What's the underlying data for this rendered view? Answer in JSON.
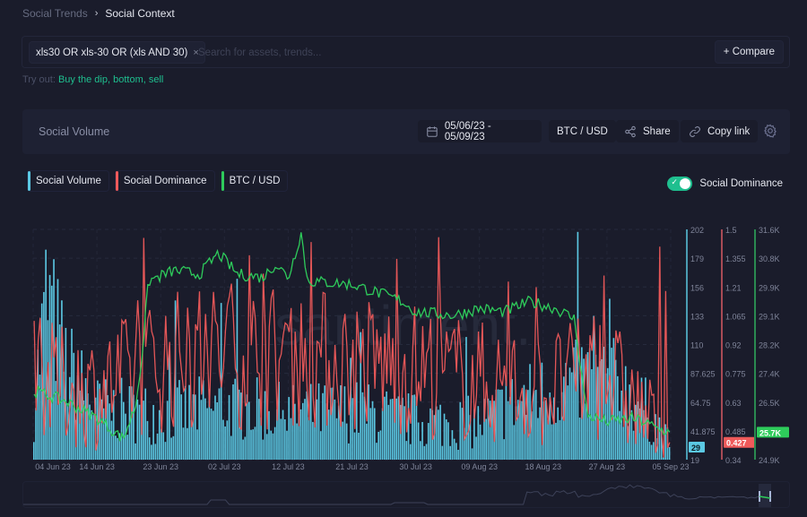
{
  "breadcrumb": {
    "parent": "Social Trends",
    "separator": "›",
    "current": "Social Context"
  },
  "search": {
    "tag": "xls30 OR xls-30 OR (xls AND 30)",
    "tag_close": "×",
    "placeholder": "Search for assets, trends...",
    "compare_label": "+ Compare"
  },
  "tryout": {
    "label": "Try out:",
    "suggestions": "Buy the dip, bottom, sell"
  },
  "panel": {
    "title": "Social Volume",
    "date_range": "05/06/23 - 05/09/23",
    "pair": "BTC / USD",
    "share_label": "Share",
    "copy_link_label": "Copy link"
  },
  "legend": [
    {
      "label": "Social Volume",
      "color": "#5bc8e3"
    },
    {
      "label": "Social Dominance",
      "color": "#ef5a5a"
    },
    {
      "label": "BTC / USD",
      "color": "#2ecc5b"
    }
  ],
  "toggle": {
    "label": "Social Dominance",
    "on": true
  },
  "watermark": "santiment.",
  "chart_data": {
    "type": "line",
    "title": "Social Volume",
    "x_ticks": [
      "04 Jun 23",
      "14 Jun 23",
      "23 Jun 23",
      "02 Jul 23",
      "12 Jul 23",
      "21 Jul 23",
      "30 Jul 23",
      "09 Aug 23",
      "18 Aug 23",
      "27 Aug 23",
      "05 Sep 23"
    ],
    "x_range": [
      "04 Jun 23",
      "05 Sep 23"
    ],
    "axes": [
      {
        "name": "Social Volume",
        "color": "#5bc8e3",
        "range": [
          19,
          202
        ],
        "ticks": [
          "202",
          "179",
          "156",
          "133",
          "110",
          "87.625",
          "64.75",
          "41.875",
          "19"
        ],
        "latest": "29",
        "latest_value": 29
      },
      {
        "name": "Social Dominance",
        "color": "#ef5a5a",
        "range": [
          0.34,
          1.5
        ],
        "ticks": [
          "1.5",
          "1.355",
          "1.21",
          "1.065",
          "0.92",
          "0.775",
          "0.63",
          "0.485",
          "0.34"
        ],
        "latest": "0.427",
        "latest_value": 0.427
      },
      {
        "name": "BTC / USD",
        "color": "#2ecc5b",
        "range": [
          24900,
          31600
        ],
        "ticks": [
          "31.6K",
          "30.8K",
          "29.9K",
          "29.1K",
          "28.2K",
          "27.4K",
          "26.5K",
          "25.7K",
          "24.9K"
        ],
        "latest": "25.7K",
        "latest_value": 25700
      }
    ],
    "series": [
      {
        "name": "Social Volume",
        "kind": "bar",
        "axis": 0,
        "color": "#5bc8e3",
        "keypoints": [
          [
            0,
            60
          ],
          [
            0.02,
            150
          ],
          [
            0.05,
            95
          ],
          [
            0.1,
            60
          ],
          [
            0.2,
            55
          ],
          [
            0.3,
            62
          ],
          [
            0.4,
            55
          ],
          [
            0.5,
            58
          ],
          [
            0.6,
            50
          ],
          [
            0.7,
            48
          ],
          [
            0.74,
            60
          ],
          [
            0.8,
            72
          ],
          [
            0.88,
            85
          ],
          [
            0.92,
            80
          ],
          [
            0.97,
            55
          ],
          [
            1,
            29
          ]
        ]
      },
      {
        "name": "Social Dominance",
        "kind": "line",
        "axis": 1,
        "color": "#ef5a5a",
        "keypoints": [
          [
            0,
            0.75
          ],
          [
            0.1,
            0.7
          ],
          [
            0.2,
            0.85
          ],
          [
            0.3,
            0.9
          ],
          [
            0.4,
            0.88
          ],
          [
            0.5,
            0.85
          ],
          [
            0.6,
            0.82
          ],
          [
            0.7,
            0.75
          ],
          [
            0.8,
            0.7
          ],
          [
            0.9,
            0.8
          ],
          [
            1,
            0.427
          ]
        ]
      },
      {
        "name": "BTC / USD",
        "kind": "line",
        "axis": 2,
        "color": "#2ecc5b",
        "keypoints": [
          [
            0,
            26900
          ],
          [
            0.05,
            26600
          ],
          [
            0.1,
            26100
          ],
          [
            0.14,
            25500
          ],
          [
            0.16,
            26500
          ],
          [
            0.17,
            28000
          ],
          [
            0.18,
            30100
          ],
          [
            0.22,
            30400
          ],
          [
            0.26,
            30300
          ],
          [
            0.29,
            30900
          ],
          [
            0.32,
            30300
          ],
          [
            0.36,
            30200
          ],
          [
            0.38,
            30600
          ],
          [
            0.4,
            30200
          ],
          [
            0.42,
            31500
          ],
          [
            0.43,
            30100
          ],
          [
            0.5,
            30000
          ],
          [
            0.55,
            29700
          ],
          [
            0.58,
            29500
          ],
          [
            0.6,
            29200
          ],
          [
            0.66,
            29100
          ],
          [
            0.7,
            29300
          ],
          [
            0.74,
            29200
          ],
          [
            0.78,
            29500
          ],
          [
            0.82,
            29300
          ],
          [
            0.85,
            29000
          ],
          [
            0.87,
            26200
          ],
          [
            0.9,
            26000
          ],
          [
            0.94,
            26100
          ],
          [
            0.96,
            26000
          ],
          [
            0.98,
            25800
          ],
          [
            1,
            25700
          ]
        ]
      }
    ]
  }
}
